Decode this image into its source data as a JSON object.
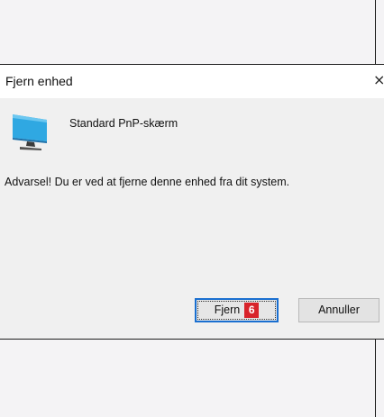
{
  "dialog": {
    "title": "Fjern enhed",
    "close_glyph": "×",
    "device_icon": "monitor-icon",
    "device_name": "Standard PnP-skærm",
    "warning": "Advarsel! Du er ved at fjerne denne enhed fra dit system.",
    "remove_label": "Fjern",
    "step_badge": "6",
    "cancel_label": "Annuller"
  },
  "colors": {
    "accent_border": "#1a6fd0",
    "badge": "#d8232a",
    "monitor_blue": "#2fa8e2"
  }
}
